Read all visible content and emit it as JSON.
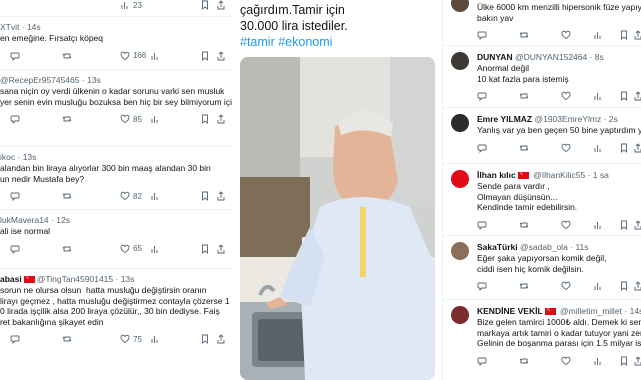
{
  "left": {
    "tweets": [
      {
        "user": "",
        "handle": "XTvit",
        "time": "14s",
        "flag": false,
        "text": [
          "en emeğine. Fırsatçı köpeq"
        ],
        "replies": "",
        "retweets": "",
        "likes": "166",
        "views": ""
      },
      {
        "user": "",
        "handle": "@RecepEr95745465",
        "time": "13s",
        "flag": false,
        "text": [
          "sana niçin oy verdi ülkenin o kadar sorunu varki sen musluk",
          "yer senin evin musluğu bozuksa ben hiç bir sey bilmiyorum için"
        ],
        "replies": "",
        "retweets": "",
        "likes": "85",
        "views": ""
      },
      {
        "user": "",
        "handle": "ikoc",
        "time": "13s",
        "flag": false,
        "text": [
          "alandan bin liraya alıyorlar 300 bin maaş alandan 30 bin",
          "un nedir Mustafa bey?"
        ],
        "replies": "",
        "retweets": "",
        "likes": "82",
        "views": ""
      },
      {
        "user": "",
        "handle": "lukMavera14",
        "time": "12s",
        "flag": false,
        "text": [
          "ali ise normal"
        ],
        "replies": "",
        "retweets": "",
        "likes": "65",
        "views": ""
      },
      {
        "user": "abasi",
        "handle": "@TingTan45901415",
        "time": "13s",
        "flag": true,
        "text": [
          "sorun ne olursa olsun  hatta musluğu değiştirsin oranın",
          "lirayı geçmez , hatta musluğu değiştirmez contayla çözerse 1",
          "0 lirada işçilik alsa 200 liraya çözülür,, 30 bin dediyse. Faiş",
          "ret bakanlığına şikayet edin"
        ],
        "replies": "",
        "retweets": "",
        "likes": "75",
        "views": ""
      }
    ],
    "top_count": "23"
  },
  "middle": {
    "text_lines": [
      "çağırdım.Tamir için",
      "30.000 lira istediler."
    ],
    "hashtags": [
      "#tamir",
      "#ekonomi"
    ]
  },
  "right": {
    "top_text": [
      "Ülke 6000 km menzilli hipersonik füze yapıyor,",
      "bakın yav"
    ],
    "tweets": [
      {
        "user": "DUNYAN",
        "handle": "@DUNYAN152464",
        "time": "8s",
        "flag": false,
        "text": [
          "Anormal değil",
          "10 kat fazla para istemiş"
        ]
      },
      {
        "user": "Emre YILMAZ",
        "handle": "@1903EmreYlmz",
        "time": "2s",
        "flag": false,
        "text": [
          "Yanlış var ya ben geçen 50 bine yaptırdım yine da"
        ]
      },
      {
        "user": "İlhan kılıc",
        "handle": "@IlhanKilic55",
        "time": "1 sa",
        "flag": true,
        "text": [
          "Sende para vardır ,",
          "Olmayan düşünsün...",
          "Kendinde tamir edebilirsin."
        ]
      },
      {
        "user": "SakaTürki",
        "handle": "@sadab_ola",
        "time": "11s",
        "flag": false,
        "text": [
          "Eğer şaka yapıyorsan komik değil,",
          "ciddi isen hiç komik değilsin."
        ]
      },
      {
        "user": "KENDİNE VEKİL",
        "handle": "@milletim_millet",
        "time": "14s",
        "flag": true,
        "text": [
          "Bize gelen tamirci 1000₺ aldı. Demek ki senin kulı",
          "markaya artık tamiri o kadar tutuyor yani zenginl",
          "Gelinin de boşanma parası için 1.5 milyar istemişti"
        ]
      }
    ]
  }
}
